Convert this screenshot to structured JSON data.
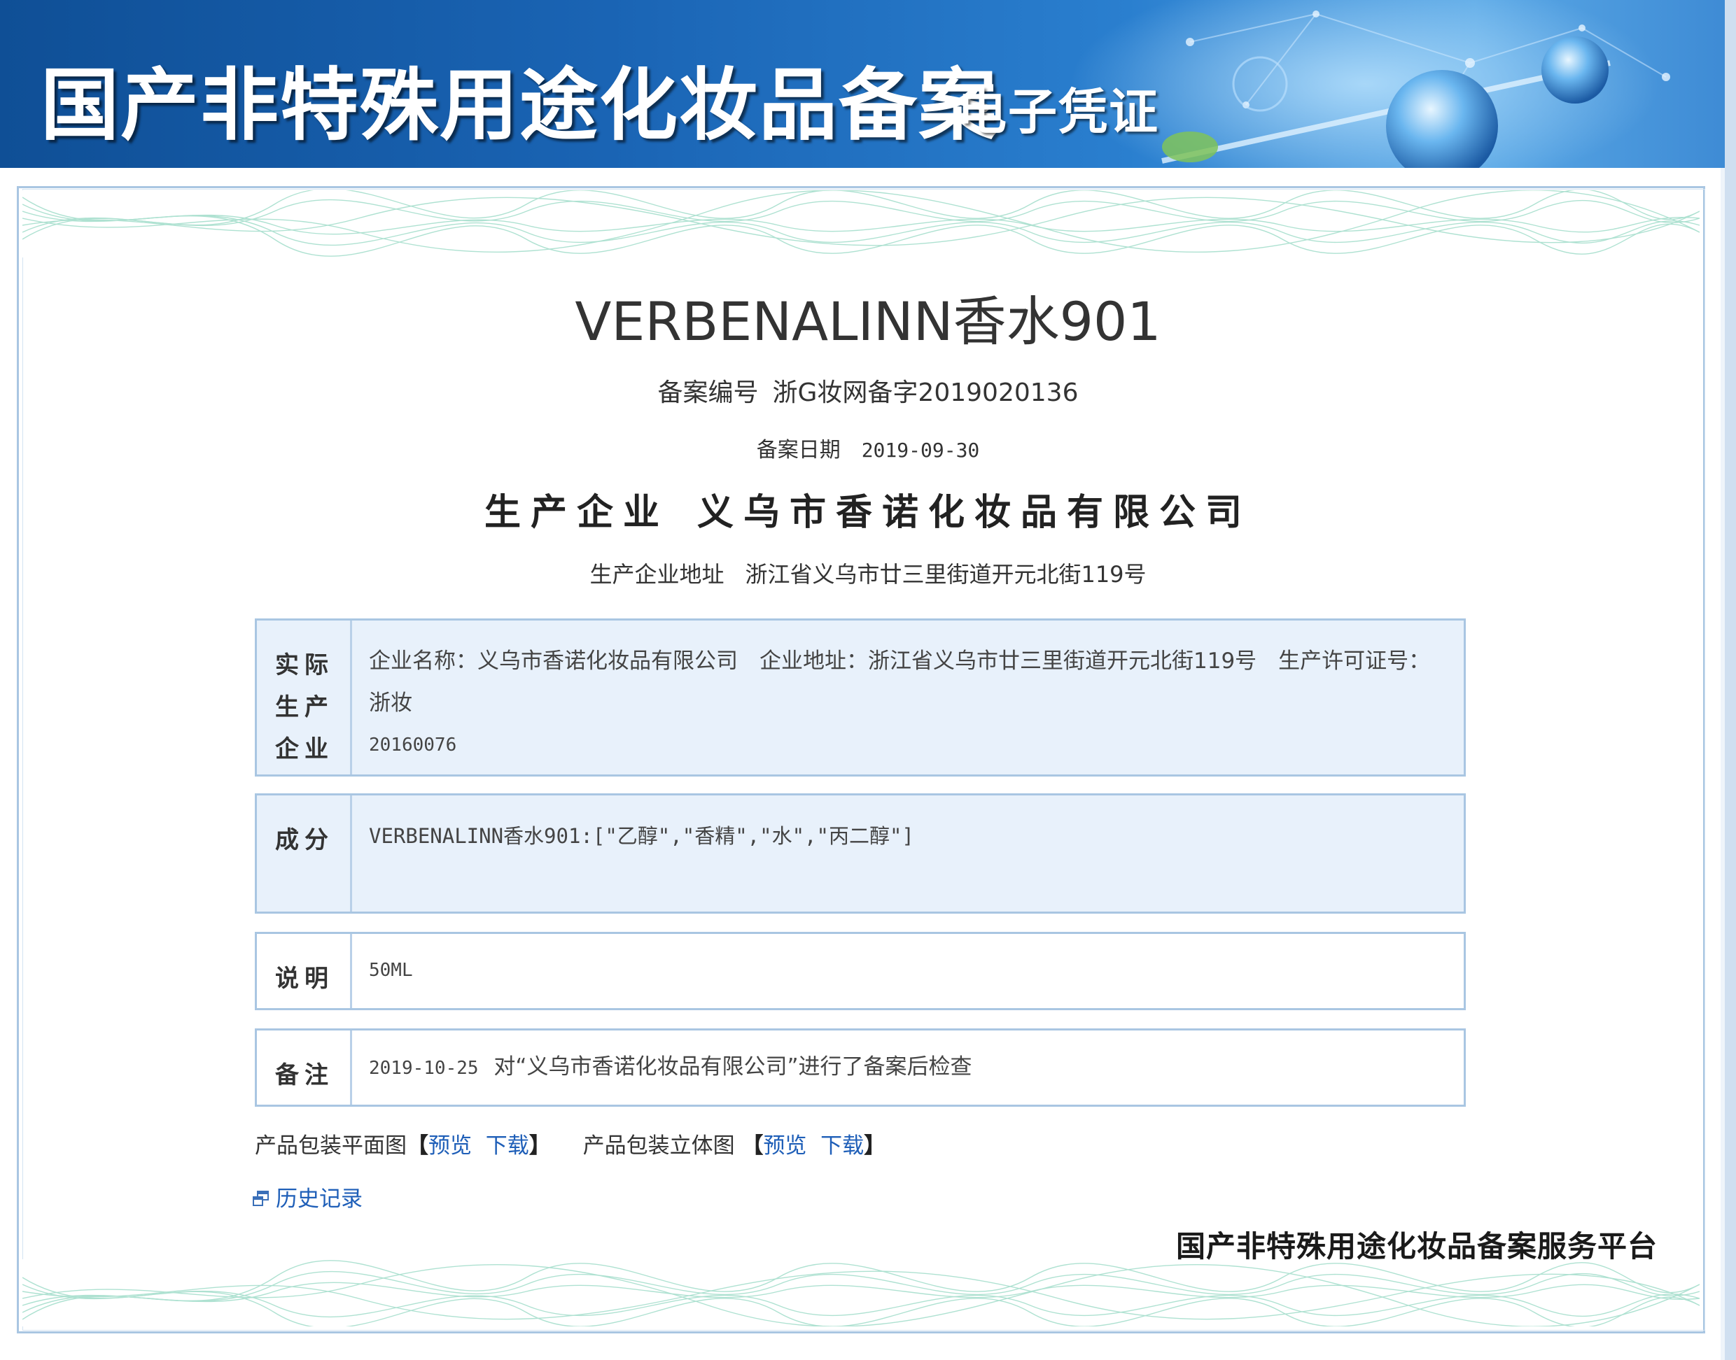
{
  "header": {
    "title": "国产非特殊用途化妆品备案",
    "subtitle": "电子凭证"
  },
  "product": {
    "name": "VERBENALINN香水901",
    "reg_no_label": "备案编号",
    "reg_no": "浙G妆网备字2019020136",
    "reg_date_label": "备案日期",
    "reg_date": "2019-09-30",
    "maker_label": "生产企业",
    "maker": "义乌市香诺化妆品有限公司",
    "maker_addr_label": "生产企业地址",
    "maker_addr": "浙江省义乌市廿三里街道开元北街119号"
  },
  "sections": {
    "actual_maker": {
      "label": [
        "实际",
        "生产",
        "企业"
      ],
      "line1": "企业名称：义乌市香诺化妆品有限公司　企业地址：浙江省义乌市廿三里街道开元北街119号　生产许可证号：浙妆",
      "line2": "20160076"
    },
    "ingredients": {
      "label": "成分",
      "text": "VERBENALINN香水901:[\"乙醇\",\"香精\",\"水\",\"丙二醇\"]"
    },
    "description": {
      "label": "说明",
      "text": "50ML"
    },
    "remark": {
      "label": "备注",
      "date": "2019-10-25",
      "text": "对“义乌市香诺化妆品有限公司”进行了备案后检查"
    }
  },
  "links": {
    "flat_label": "产品包装平面图",
    "solid_label": "产品包装立体图",
    "preview": "预览",
    "download": "下载",
    "bracket_open": "【",
    "bracket_close": "】",
    "history": "历史记录"
  },
  "footer": {
    "platform": "国产非特殊用途化妆品备案服务平台"
  },
  "colors": {
    "banner": "#1a64b4",
    "link": "#1f5fb8",
    "box_fill": "#e8f1fb",
    "box_border": "#a9c6e2"
  }
}
